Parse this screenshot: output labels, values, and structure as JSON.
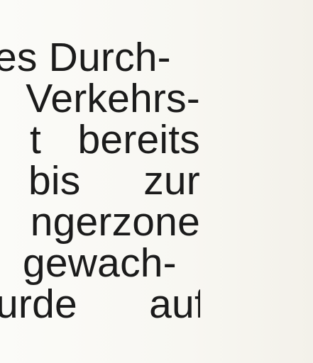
{
  "document": {
    "lines": [
      {
        "text": "es Durch-"
      },
      {
        "text": "Verkehrs-"
      },
      {
        "words": [
          "t",
          "bereits"
        ]
      },
      {
        "words": [
          "bis",
          "zur"
        ]
      },
      {
        "text": "ngerzone"
      },
      {
        "words": [
          "gewach-"
        ]
      },
      {
        "words": [
          "urde",
          "auf"
        ]
      }
    ]
  }
}
